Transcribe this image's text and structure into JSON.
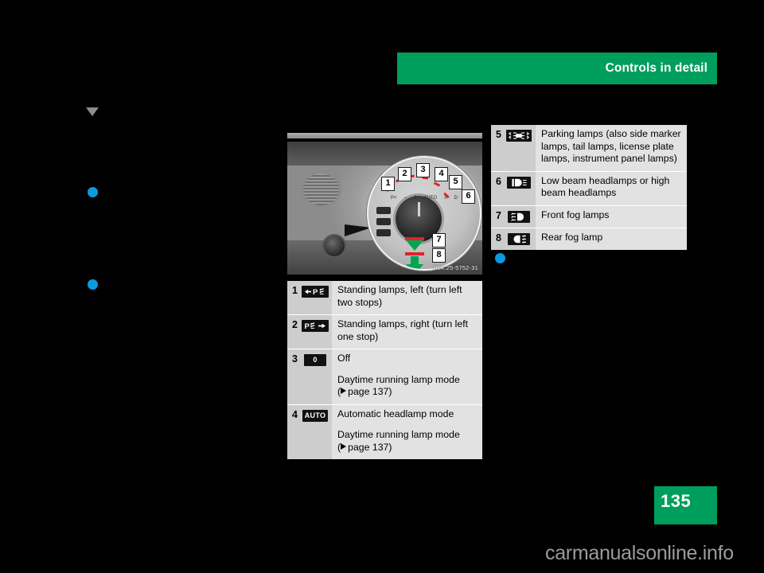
{
  "header": {
    "title": "Controls in detail"
  },
  "figure": {
    "code": "P54.25-5752-31",
    "callouts": [
      "1",
      "2",
      "3",
      "4",
      "5",
      "6",
      "7",
      "8"
    ]
  },
  "markers": {
    "triangle": "section-marker",
    "dot": "bullet-marker"
  },
  "tables": {
    "right": [
      {
        "num": "5",
        "icon": "parking-lamps-icon",
        "icon_glyph": "☰",
        "lines": [
          "Parking lamps (also side marker lamps, tail lamps, license plate lamps, instrument panel lamps)"
        ]
      },
      {
        "num": "6",
        "icon": "low-beam-headlamps-icon",
        "icon_glyph": "",
        "lines": [
          "Low beam headlamps or high beam headlamps"
        ]
      },
      {
        "num": "7",
        "icon": "front-fog-lamps-icon",
        "icon_glyph": "",
        "lines": [
          "Front fog lamps"
        ]
      },
      {
        "num": "8",
        "icon": "rear-fog-lamp-icon",
        "icon_glyph": "",
        "lines": [
          "Rear fog lamp"
        ]
      }
    ],
    "left": [
      {
        "num": "1",
        "icon": "standing-lamps-left-icon",
        "lines": [
          "Standing lamps, left (turn left two stops)"
        ]
      },
      {
        "num": "2",
        "icon": "standing-lamps-right-icon",
        "lines": [
          "Standing lamps, right (turn left one stop)"
        ]
      },
      {
        "num": "3",
        "icon": "off-position-icon",
        "icon_label": "0",
        "lines": [
          "Off",
          "Daytime running lamp mode"
        ],
        "ref": "( page 137)",
        "ref_prefix": "(",
        "ref_text": "page 137)"
      },
      {
        "num": "4",
        "icon": "auto-headlamp-icon",
        "icon_label": "AUTO",
        "lines": [
          "Automatic headlamp mode",
          "Daytime running lamp mode"
        ],
        "ref_prefix": "(",
        "ref_text": "page 137)"
      }
    ]
  },
  "footer": {
    "page_number": "135",
    "watermark": "carmanualsonline.info"
  },
  "colors": {
    "brand_green": "#009e5c",
    "marker_blue": "#0a9ae0",
    "table_bg": "#e2e2e2",
    "table_num_bg": "#cdcdcd",
    "accent_red": "#e0222a",
    "arrow_green": "#00a550"
  }
}
